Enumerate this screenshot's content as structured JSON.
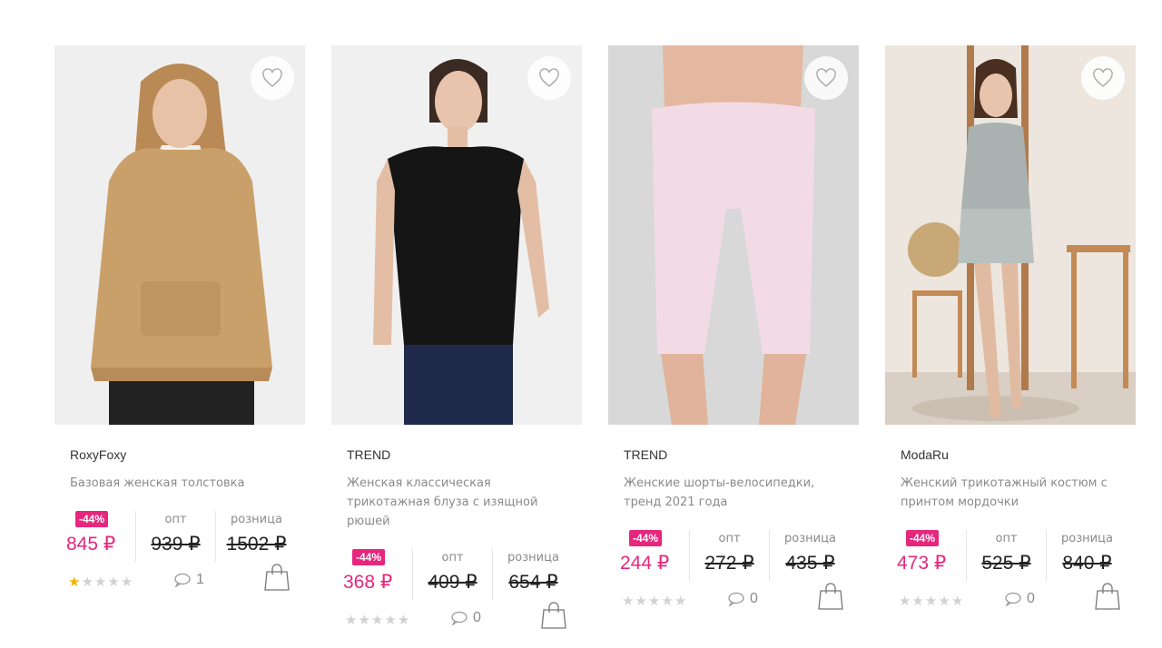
{
  "products": [
    {
      "brand": "RoxyFoxy",
      "title": "Базовая женская толстовка",
      "discount": "-44%",
      "price": "845 ₽",
      "opt_label": "опт",
      "opt_price": "939 ₽",
      "retail_label": "розница",
      "retail_price": "1502 ₽",
      "rating": 1,
      "reviews": "1"
    },
    {
      "brand": "TREND",
      "title": "Женская классическая трикотажная блуза с изящной рюшей",
      "discount": "-44%",
      "price": "368 ₽",
      "opt_label": "опт",
      "opt_price": "409 ₽",
      "retail_label": "розница",
      "retail_price": "654 ₽",
      "rating": 0,
      "reviews": "0"
    },
    {
      "brand": "TREND",
      "title": "Женские шорты-велосипедки, тренд 2021 года",
      "discount": "-44%",
      "price": "244 ₽",
      "opt_label": "опт",
      "opt_price": "272 ₽",
      "retail_label": "розница",
      "retail_price": "435 ₽",
      "rating": 0,
      "reviews": "0"
    },
    {
      "brand": "ModaRu",
      "title": "Женский трикотажный костюм с принтом мордочки",
      "discount": "-44%",
      "price": "473 ₽",
      "opt_label": "опт",
      "opt_price": "525 ₽",
      "retail_label": "розница",
      "retail_price": "840 ₽",
      "rating": 0,
      "reviews": "0"
    }
  ],
  "colors": {
    "accent": "#e6277d",
    "muted": "#8a8a8a",
    "star_on": "#f5b400",
    "star_off": "#d2d2d2"
  },
  "icons": [
    "heart-icon",
    "comment-icon",
    "shopping-bag-icon",
    "star-icon"
  ]
}
